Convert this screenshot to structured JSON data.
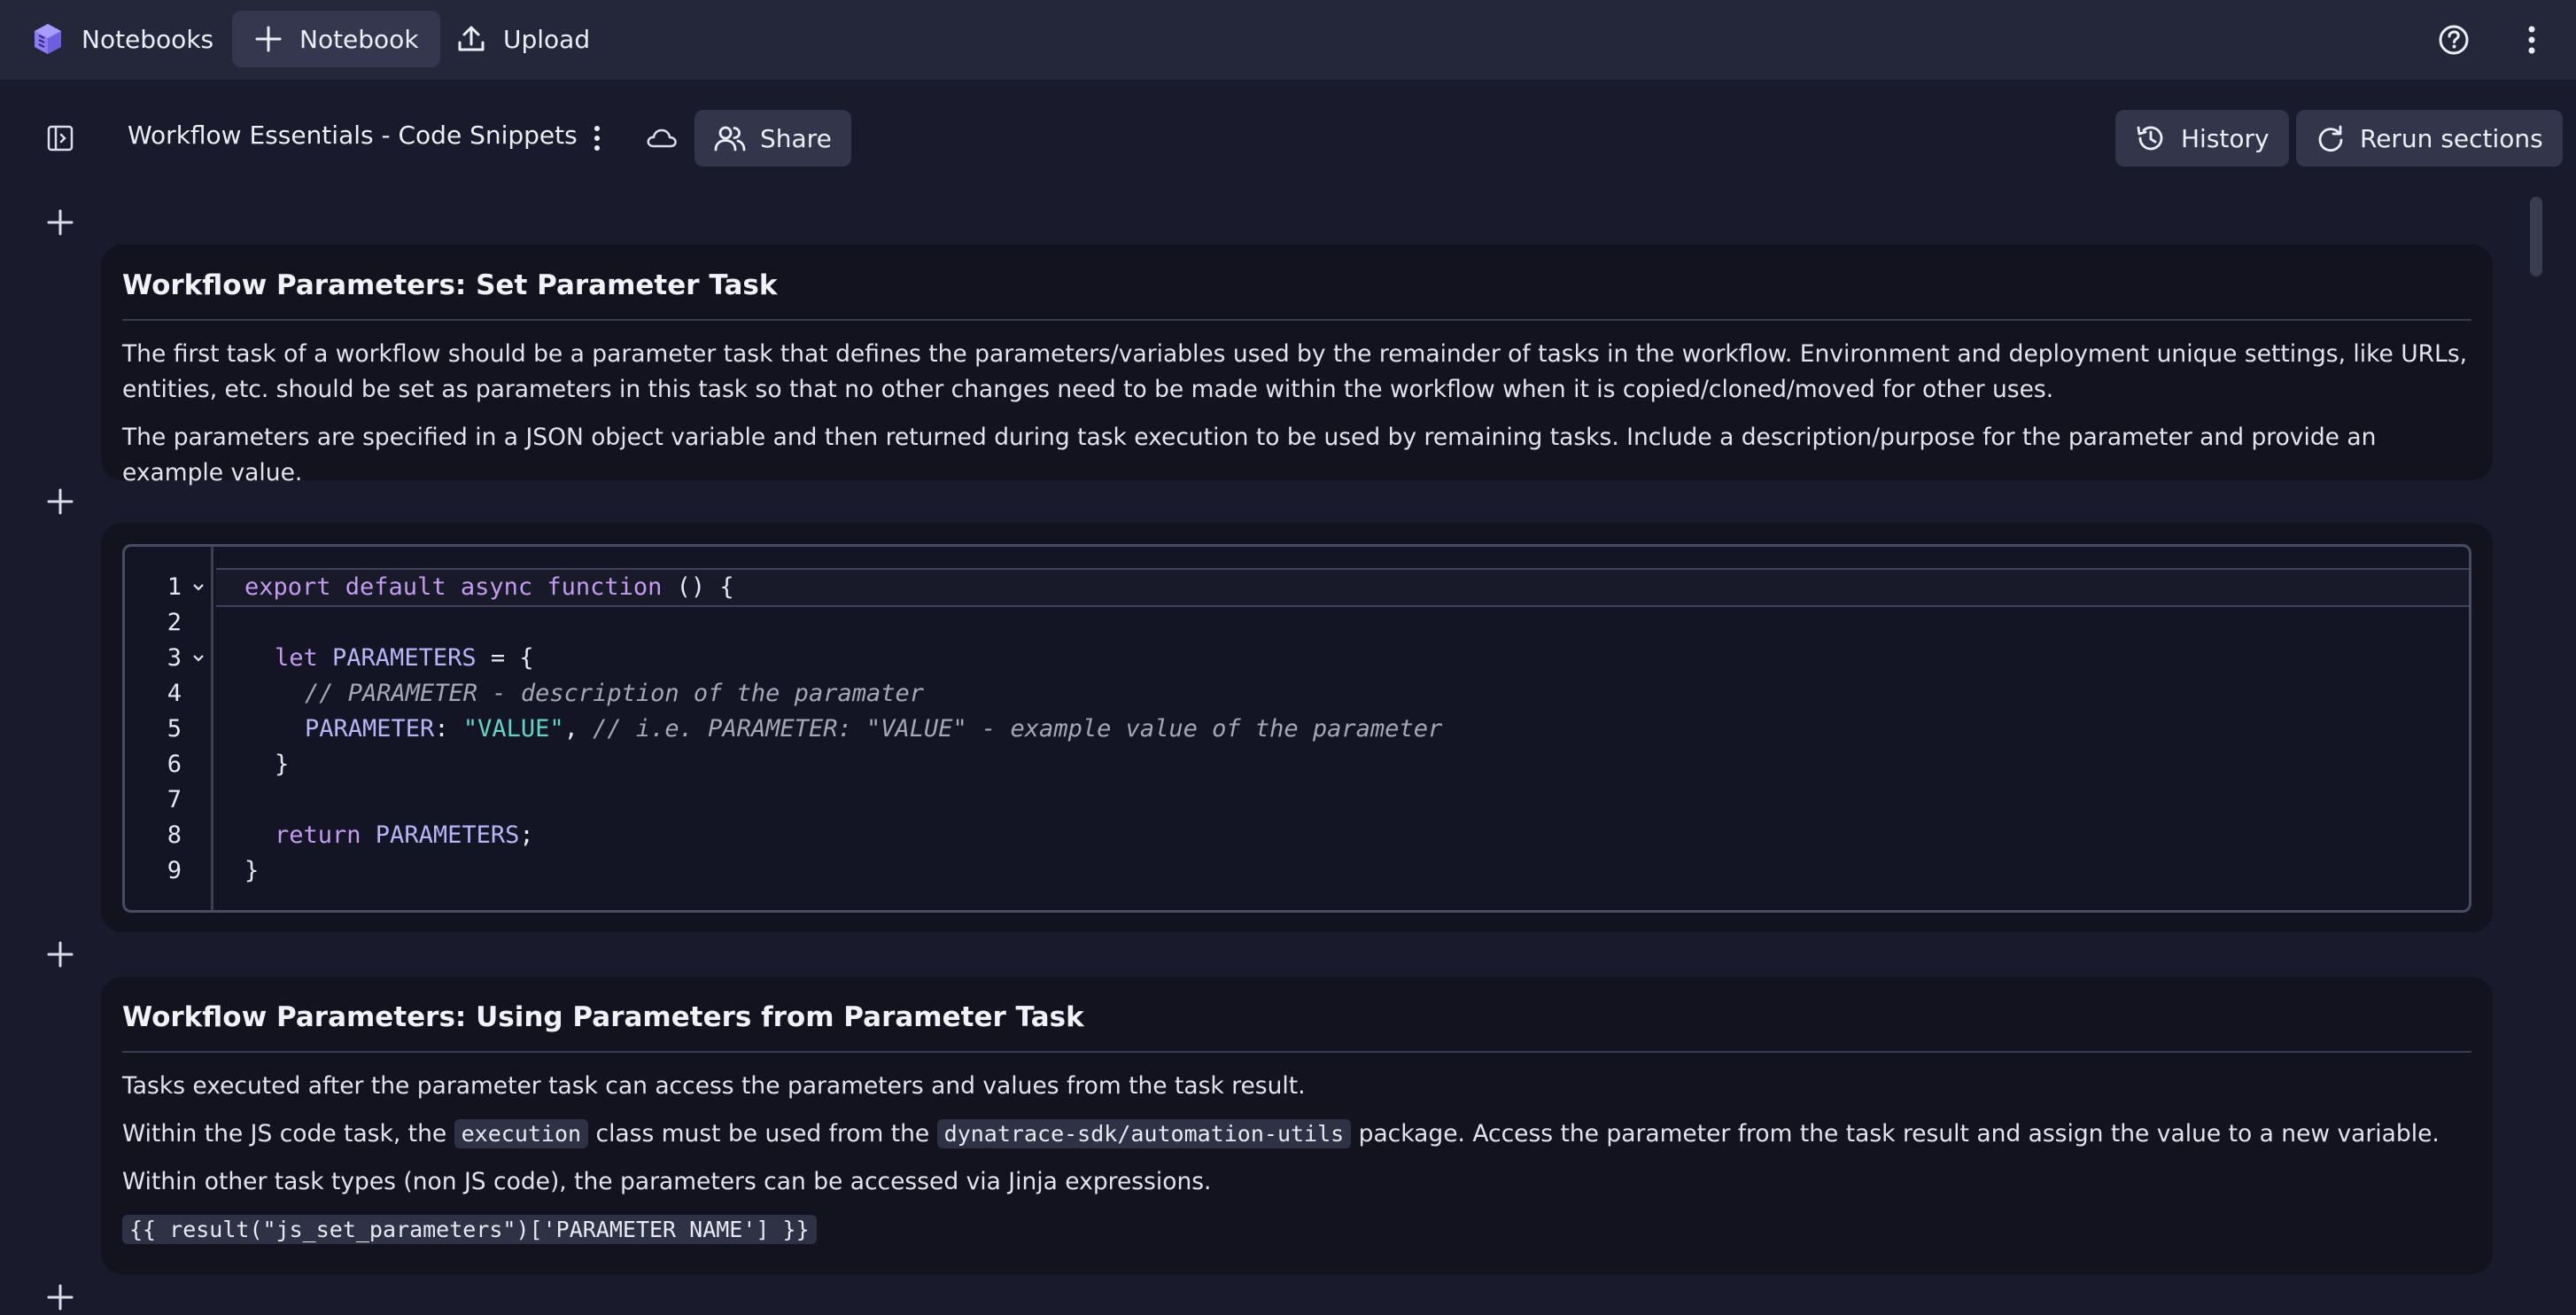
{
  "topbar": {
    "app_name": "Notebooks",
    "notebook_button": "Notebook",
    "upload_button": "Upload"
  },
  "toolbar": {
    "title": "Workflow Essentials - Code Snippets",
    "share_label": "Share",
    "history_label": "History",
    "rerun_label": "Rerun sections"
  },
  "sections": {
    "s1": {
      "title": "Workflow Parameters: Set Parameter Task",
      "p1": "The first task of a workflow should be a parameter task that defines the parameters/variables used by the remainder of tasks in the workflow. Environment and deployment unique settings, like URLs, entities, etc. should be set as parameters in this task so that no other changes need to be made within the workflow when it is copied/cloned/moved for other uses.",
      "p2": "The parameters are specified in a JSON object variable and then returned during task execution to be used by remaining tasks. Include a description/purpose for the parameter and provide an example value."
    },
    "code": {
      "line_numbers": [
        "1",
        "2",
        "3",
        "4",
        "5",
        "6",
        "7",
        "8",
        "9"
      ],
      "l1": {
        "kw1": "export default async function",
        "rest": " () {"
      },
      "l3": {
        "kw": "let",
        "id": " PARAMETERS",
        "rest": " = {"
      },
      "l4": {
        "comment": "// PARAMETER - description of the paramater"
      },
      "l5": {
        "id": "PARAMETER",
        "colon": ": ",
        "str": "\"VALUE\"",
        "comma": ", ",
        "comment": "// i.e. PARAMETER: \"VALUE\" - example value of the parameter"
      },
      "l6": {
        "text": "}"
      },
      "l8": {
        "kw": "return",
        "id": " PARAMETERS",
        "rest": ";"
      },
      "l9": {
        "text": "}"
      }
    },
    "s3": {
      "title": "Workflow Parameters: Using Parameters from Parameter Task",
      "p1": "Tasks executed after the parameter task can access the parameters and values from the task result.",
      "p2_a": "Within the JS code task, the ",
      "p2_code1": "execution",
      "p2_b": " class must be used from the ",
      "p2_code2": "dynatrace-sdk/automation-utils",
      "p2_c": " package. Access the parameter from the task result and assign the value to a new variable.",
      "p3": "Within other task types (non JS code), the parameters can be accessed via Jinja expressions.",
      "p4_code": "{{ result(\"js_set_parameters\")['PARAMETER NAME'] }}"
    }
  },
  "icons": {
    "app_logo": "notebooks-cube-icon",
    "plus": "plus-icon",
    "upload": "upload-icon",
    "help": "help-circle-icon",
    "more": "more-vertical-icon",
    "sidebar": "sidebar-toggle-icon",
    "cloud": "cloud-saved-icon",
    "share": "users-icon",
    "history": "history-icon",
    "rerun": "refresh-icon"
  },
  "colors": {
    "background": "#191a2b",
    "topbar": "#24263a",
    "section": "#12131f",
    "keyword": "#c49bf0",
    "identifier": "#b7b4f7",
    "string": "#62d6c6",
    "comment": "#a5a6b8",
    "accent_logo": "#8b7cf6"
  }
}
